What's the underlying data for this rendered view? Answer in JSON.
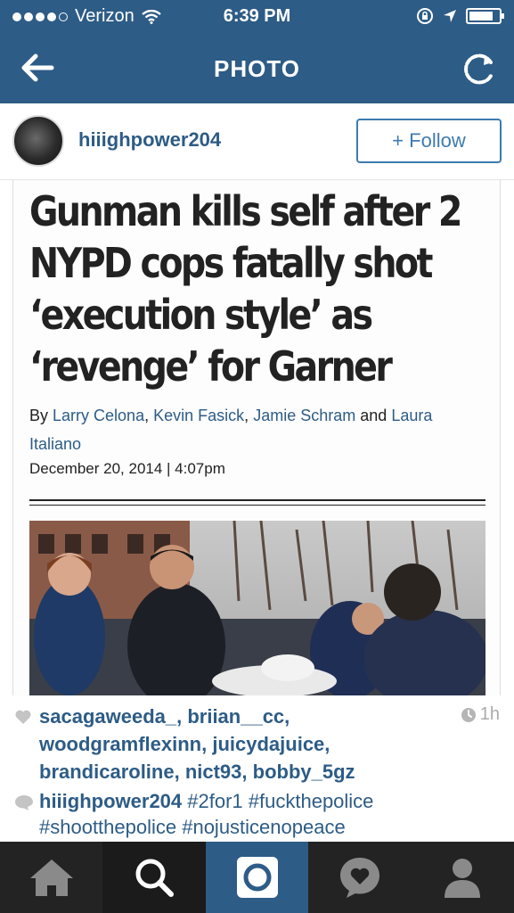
{
  "status_bar": {
    "carrier": "Verizon",
    "time": "6:39 PM",
    "signal_bars": 4
  },
  "nav": {
    "title": "PHOTO"
  },
  "post": {
    "username": "hiiighpower204",
    "follow_label": "+ Follow"
  },
  "article": {
    "headline": "Gunman kills self after 2 NYPD cops fatally shot ‘execution style’ as ‘revenge’ for Garner",
    "by_prefix": "By",
    "authors": [
      "Larry Celona",
      "Kevin Fasick",
      "Jamie Schram",
      "Laura Italiano"
    ],
    "sep_comma": ",",
    "sep_and": "and",
    "date": "December 20, 2014 | 4:07pm"
  },
  "likes": {
    "names": "sacagaweeda_, briian__cc, woodgramflexinn, juicydajuice, brandicaroline, nict93, bobby_5gz",
    "time_ago": "1h"
  },
  "caption": {
    "user": "hiiighpower204",
    "text": "#2for1 #fuckthepolice #shootthepolice #nojusticenopeace"
  },
  "tabs": [
    "home-icon",
    "search-icon",
    "camera-icon",
    "activity-icon",
    "profile-icon"
  ],
  "colors": {
    "header": "#2d5c86",
    "link": "#2d5c86",
    "follow_border": "#3e7bb0",
    "tabbar": "#232323"
  }
}
